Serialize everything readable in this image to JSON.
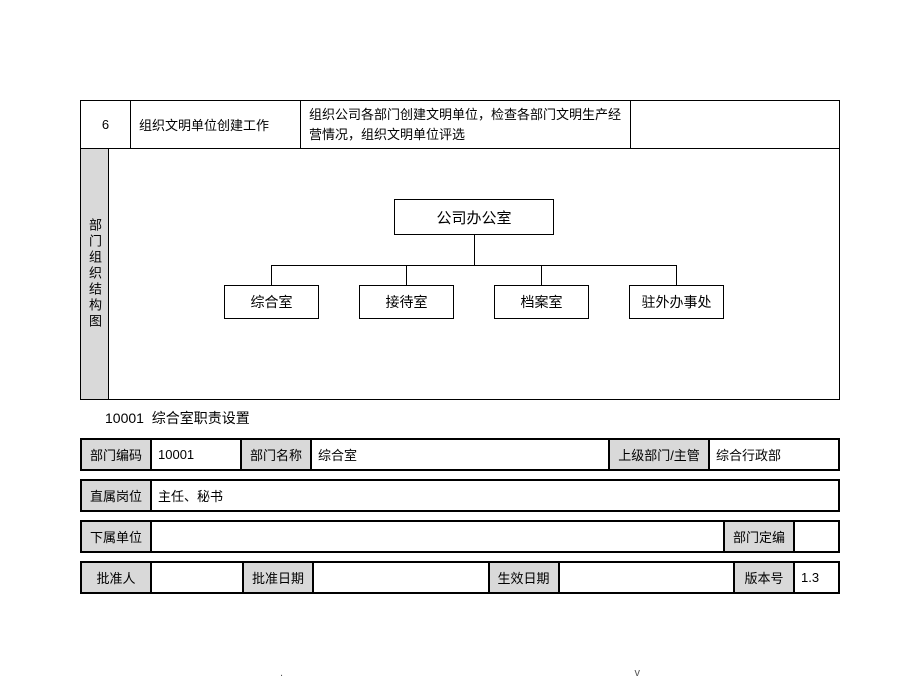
{
  "task": {
    "num": "6",
    "title": "组织文明单位创建工作",
    "desc": "组织公司各部门创建文明单位，检查各部门文明生产经营情况，组织文明单位评选"
  },
  "org": {
    "label": "部门组织结构图",
    "top": "公司办公室",
    "children": [
      "综合室",
      "接待室",
      "档案室",
      "驻外办事处"
    ]
  },
  "section": {
    "code": "10001",
    "title": "综合室职责设置"
  },
  "info": {
    "dept_code_label": "部门编码",
    "dept_code": "10001",
    "dept_name_label": "部门名称",
    "dept_name": "综合室",
    "superior_label": "上级部门/主管",
    "superior": "综合行政部",
    "direct_pos_label": "直属岗位",
    "direct_pos": "主任、秘书",
    "sub_unit_label": "下属单位",
    "sub_unit": "",
    "headcount_label": "部门定编",
    "headcount": "",
    "approver_label": "批准人",
    "approver": "",
    "approve_date_label": "批准日期",
    "approve_date": "",
    "effective_date_label": "生效日期",
    "effective_date": "",
    "version_label": "版本号",
    "version": "1.3"
  },
  "footer": {
    "left": ".",
    "right": "v"
  }
}
